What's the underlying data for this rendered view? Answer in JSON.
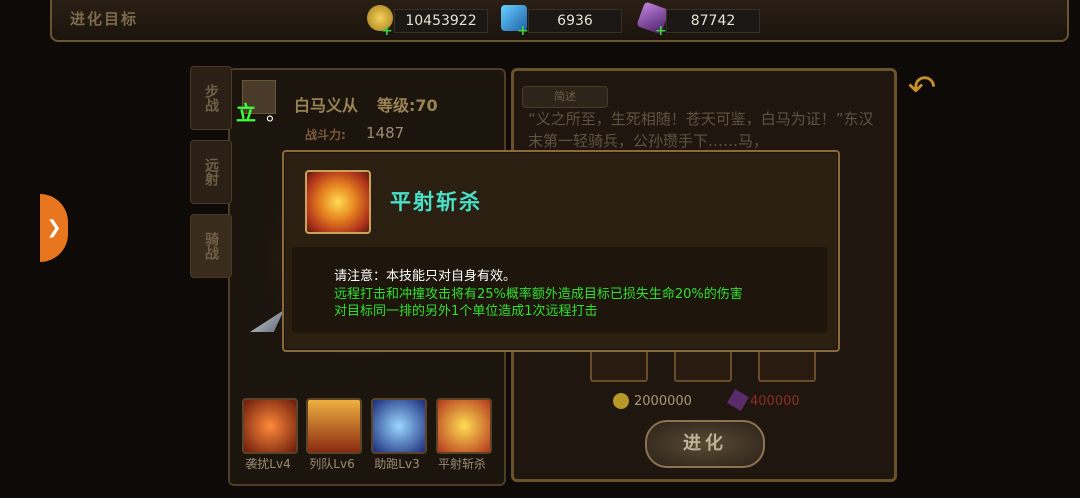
{
  "header": {
    "title": "进化目标",
    "resources": {
      "gold": "10453922",
      "gems": "6936",
      "crystals": "87742"
    },
    "icons": {
      "gold": "gold-coin-icon",
      "gems": "blue-gem-icon",
      "crystals": "purple-crystal-icon",
      "add": "plus-icon"
    }
  },
  "hero": {
    "fragment_text": "立",
    "fragment_dot": "。",
    "name": "白马义从",
    "level": "等级:70",
    "power_label": "战斗力:",
    "power": "1487",
    "tabs": [
      "步战",
      "远射",
      "骑战"
    ]
  },
  "skills": [
    {
      "label": "袭扰Lv4"
    },
    {
      "label": "列队Lv6"
    },
    {
      "label": "助跑Lv3"
    },
    {
      "label": "平射斩杀"
    }
  ],
  "biography": {
    "tab": "简述",
    "text": "“义之所至，生死相随！苍天可鉴，白马为证！”东汉末第一轻骑兵，公孙瓒手下……马，"
  },
  "evolve": {
    "cost_gold": "2000000",
    "cost_crystal": "400000",
    "button_label": "进化"
  },
  "popup": {
    "skill_name": "平射斩杀",
    "note": "请注意：本技能只对自身有效。",
    "effect_line1": "远程打击和冲撞攻击将有25%概率额外造成目标已损失生命20%的伤害",
    "effect_line2": "对目标同一排的另外1个单位造成1次远程打击"
  },
  "colors": {
    "accent": "#49e0c8",
    "effect_text": "#30e030",
    "frame": "#8a6a3c"
  }
}
